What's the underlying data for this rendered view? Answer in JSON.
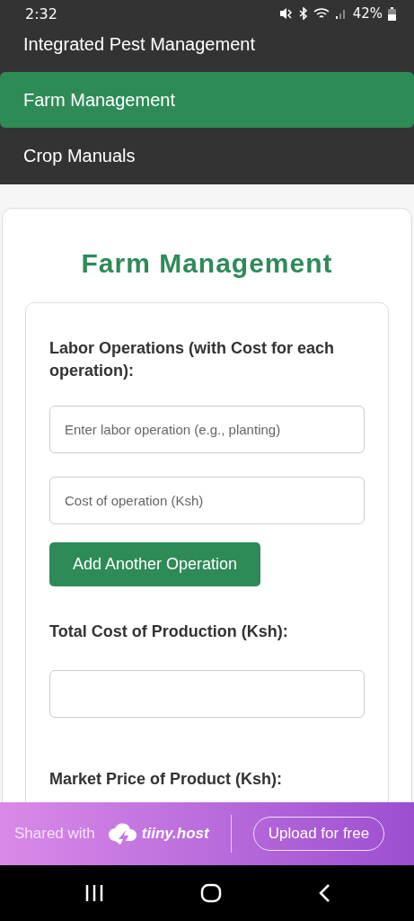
{
  "status_bar": {
    "time": "2:32",
    "battery": "42%"
  },
  "nav": {
    "items": [
      {
        "label": "Integrated Pest Management",
        "selected": false
      },
      {
        "label": "Farm Management",
        "selected": true
      },
      {
        "label": "Crop Manuals",
        "selected": false
      }
    ]
  },
  "page": {
    "title": "Farm Management",
    "labor_label": "Labor Operations (with Cost for each operation):",
    "operation_field": {
      "placeholder": "Enter labor operation (e.g., planting)"
    },
    "cost_field": {
      "placeholder": "Cost of operation (Ksh)"
    },
    "add_button": "Add Another Operation",
    "total_label": "Total Cost of Production (Ksh):",
    "market_label": "Market Price of Product (Ksh):"
  },
  "banner": {
    "shared_with": "Shared with",
    "brand": "tiiny.host",
    "upload_button": "Upload for free"
  }
}
